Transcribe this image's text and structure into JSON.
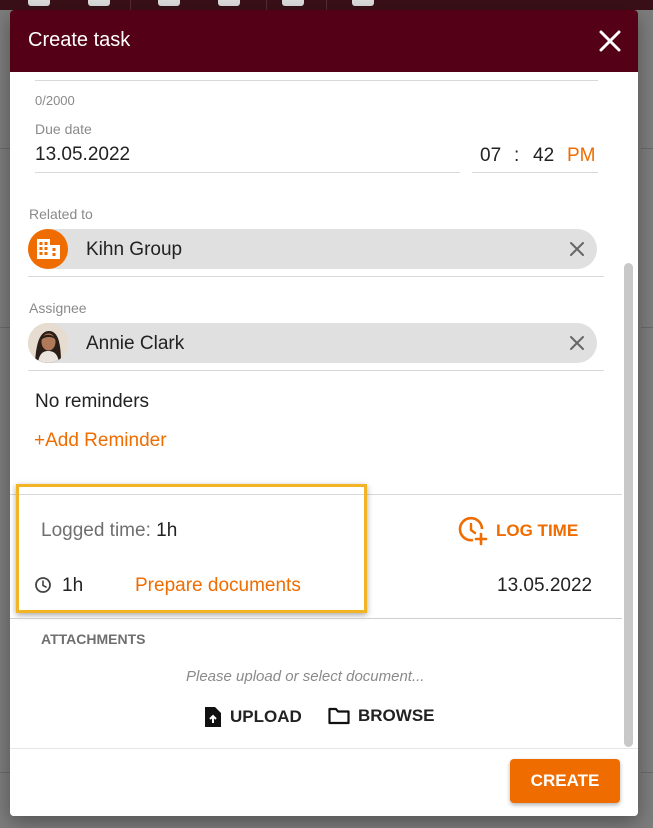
{
  "dialog": {
    "title": "Create task"
  },
  "description": {
    "char_counter": "0/2000"
  },
  "due": {
    "label": "Due date",
    "date": "13.05.2022",
    "hour": "07",
    "separator": ":",
    "minute": "42",
    "ampm": "PM"
  },
  "related": {
    "label": "Related to",
    "value": "Kihn Group",
    "icon": "building-icon"
  },
  "assignee": {
    "label": "Assignee",
    "value": "Annie Clark",
    "icon": "avatar"
  },
  "reminders": {
    "empty_text": "No reminders",
    "add_label": "+Add Reminder"
  },
  "logged": {
    "label": "Logged time:",
    "total": "1h",
    "log_time_label": "LOG TIME",
    "entry": {
      "duration": "1h",
      "task": "Prepare documents",
      "date": "13.05.2022"
    }
  },
  "attachments": {
    "heading": "ATTACHMENTS",
    "placeholder": "Please upload or select document...",
    "upload_label": "UPLOAD",
    "browse_label": "BROWSE"
  },
  "footer": {
    "create_label": "CREATE"
  },
  "colors": {
    "header": "#540016",
    "accent": "#ef6c00",
    "highlight": "#f2b324"
  }
}
